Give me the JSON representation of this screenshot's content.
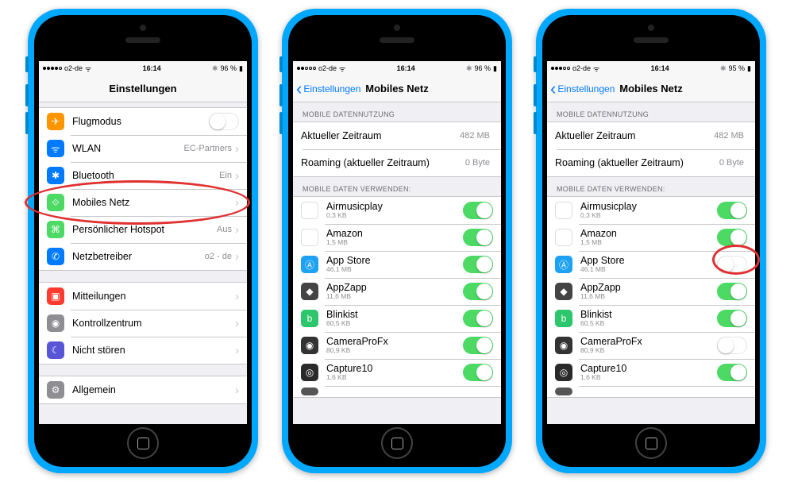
{
  "status": {
    "carrier": "o2-de",
    "time": "16:14",
    "battery1": "96 %",
    "battery3": "95 %",
    "wifi": "ᯤ",
    "bt": "⚪",
    "batt_icon": "▮"
  },
  "phone1": {
    "title": "Einstellungen",
    "rows": [
      {
        "label": "Flugmodus",
        "toggle": "off"
      },
      {
        "label": "WLAN",
        "value": "EC-Partners"
      },
      {
        "label": "Bluetooth",
        "value": "Ein"
      },
      {
        "label": "Mobiles Netz"
      },
      {
        "label": "Persönlicher Hotspot",
        "value": "Aus"
      },
      {
        "label": "Netzbetreiber",
        "value": "o2 - de"
      }
    ],
    "rows2": [
      {
        "label": "Mitteilungen"
      },
      {
        "label": "Kontrollzentrum"
      },
      {
        "label": "Nicht stören"
      }
    ],
    "rows3": [
      {
        "label": "Allgemein"
      }
    ]
  },
  "detail": {
    "back": "Einstellungen",
    "title": "Mobiles Netz",
    "header_usage": "MOBILE DATENNUTZUNG",
    "usage": [
      {
        "label": "Aktueller Zeitraum",
        "value": "482 MB"
      },
      {
        "label": "Roaming (aktueller Zeitraum)",
        "value": "0 Byte"
      }
    ],
    "header_apps": "MOBILE DATEN VERWENDEN:",
    "apps": [
      {
        "name": "Airmusicplay",
        "size": "0,3 KB"
      },
      {
        "name": "Amazon",
        "size": "1,5 MB"
      },
      {
        "name": "App Store",
        "size": "46,1 MB"
      },
      {
        "name": "AppZapp",
        "size": "11,6 MB"
      },
      {
        "name": "Blinkist",
        "size": "60,5 KB"
      },
      {
        "name": "CameraProFx",
        "size": "80,9 KB"
      },
      {
        "name": "Capture10",
        "size": "1,6 KB"
      }
    ]
  },
  "phone3_toggles": {
    "appstore_off": true,
    "camera_off": true
  }
}
